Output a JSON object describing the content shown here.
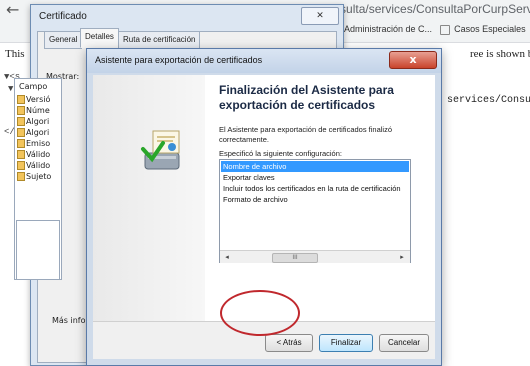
{
  "browser": {
    "url_fragment": "Consulta/services/ConsultaPorCurpServicio",
    "bookmarks": [
      "Administración de C...",
      "Casos Especiales"
    ],
    "page_text_left": "This",
    "page_text_right": "ree is shown below",
    "page_url_right": "services/Consulta",
    "xml_fragments": [
      "▼<s",
      "▼",
      "</"
    ]
  },
  "cert_dialog": {
    "title": "Certificado",
    "close_label": "✕",
    "tabs": [
      "General",
      "Detalles",
      "Ruta de certificación"
    ],
    "active_tab": "Detalles",
    "show_label": "Mostrar:",
    "field_header": "Campo",
    "fields": [
      "Versió",
      "Núme",
      "Algori",
      "Algori",
      "Emiso",
      "Válido",
      "Válido",
      "Sujeto"
    ],
    "more_info": "Más inform"
  },
  "wizard": {
    "title": "Asistente para exportación de certificados",
    "close_label": "x",
    "heading": "Finalización del Asistente para exportación de certificados",
    "description": "El Asistente para exportación de certificados finalizó correctamente.",
    "config_label": "Especificó la siguiente configuración:",
    "config_items": [
      "Nombre de archivo",
      "Exportar claves",
      "Incluir todos los certificados en la ruta de certificación",
      "Formato de archivo"
    ],
    "selected_index": 0,
    "scroll_thumb": "III",
    "buttons": {
      "back": "< Atrás",
      "finish": "Finalizar",
      "cancel": "Cancelar"
    }
  }
}
